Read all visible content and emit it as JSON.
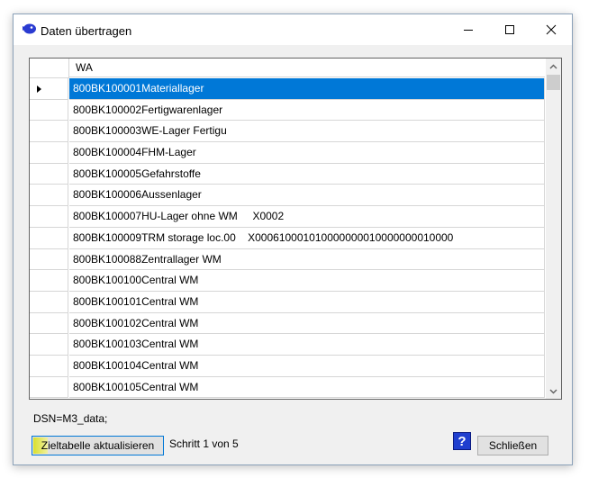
{
  "window": {
    "title": "Daten übertragen",
    "icons": {
      "app": "app-icon",
      "minimize": "minimize-icon",
      "maximize": "maximize-icon",
      "close": "close-icon"
    }
  },
  "grid": {
    "column_header": "WA",
    "rows": [
      "800BK100001Materiallager",
      "800BK100002Fertigwarenlager",
      "800BK100003WE-Lager Fertigu",
      "800BK100004FHM-Lager",
      "800BK100005Gefahrstoffe",
      "800BK100006Aussenlager",
      "800BK100007HU-Lager ohne WM     X0002",
      "800BK100009TRM storage loc.00    X000610001010000000010000000010000",
      "800BK100088Zentrallager WM",
      "800BK100100Central WM",
      "800BK100101Central WM",
      "800BK100102Central WM",
      "800BK100103Central WM",
      "800BK100104Central WM",
      "800BK100105Central WM"
    ],
    "selected_row": 0
  },
  "footer": {
    "dsn": "DSN=M3_data;",
    "update_button": "Zieltabelle aktualisieren",
    "step_text": "Schritt 1 von 5",
    "help_label": "?",
    "close_button": "Schließen"
  },
  "colors": {
    "selection": "#0078d7",
    "help": "#1f3fcf"
  }
}
